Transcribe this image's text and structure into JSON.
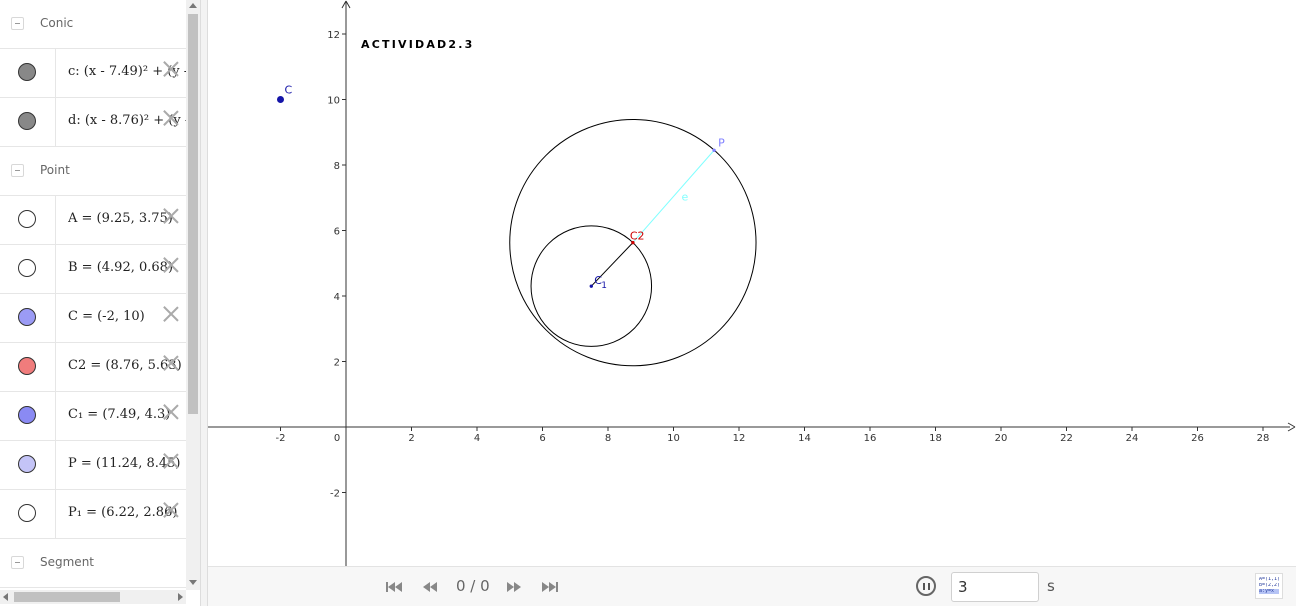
{
  "algebra": {
    "groups": [
      {
        "label": "Conic",
        "items": [
          {
            "color": "#888888",
            "text": "c: (x - 7.49)² + (y -"
          },
          {
            "color": "#888888",
            "text": "d: (x - 8.76)² + (y -"
          }
        ]
      },
      {
        "label": "Point",
        "items": [
          {
            "color": "#ffffff",
            "text": "A = (9.25, 3.75)"
          },
          {
            "color": "#ffffff",
            "text": "B = (4.92, 0.68)"
          },
          {
            "color": "#9b9bf5",
            "text": "C = (-2, 10)"
          },
          {
            "color": "#f07c7c",
            "text": "C2 = (8.76, 5.63)"
          },
          {
            "color": "#8a8af3",
            "text": "C₁ = (7.49, 4.3)"
          },
          {
            "color": "#c4c4f7",
            "text": "P = (11.24, 8.45)"
          },
          {
            "color": "#ffffff",
            "text": "P₁ = (6.22, 2.86)"
          }
        ]
      },
      {
        "label": "Segment",
        "items": []
      }
    ]
  },
  "graphics": {
    "title": "ACTIVIDAD2.3",
    "x_ticks": [
      "-2",
      "0",
      "2",
      "4",
      "6",
      "8",
      "10",
      "12",
      "14",
      "16",
      "18",
      "20",
      "22",
      "24",
      "26",
      "28"
    ],
    "y_ticks": [
      "12",
      "10",
      "8",
      "6",
      "4",
      "2",
      "-2"
    ],
    "objects": {
      "circle_c": {
        "center": [
          7.49,
          4.3
        ],
        "radius": 1.84,
        "color": "#000000"
      },
      "circle_d": {
        "center": [
          8.76,
          5.63
        ],
        "radius": 3.76,
        "color": "#000000"
      },
      "segment_e": {
        "from": [
          8.76,
          5.63
        ],
        "to": [
          11.24,
          8.45
        ],
        "color": "#80ffff",
        "label": "e"
      },
      "segment_c1_c2": {
        "from": [
          7.49,
          4.3
        ],
        "to": [
          8.76,
          5.63
        ],
        "color": "#000000"
      },
      "point_C": {
        "coords": [
          -2,
          10
        ],
        "label": "C",
        "color": "#1515a8"
      },
      "point_P": {
        "coords": [
          11.24,
          8.45
        ],
        "label": "P",
        "color": "#7f7fff"
      },
      "point_C2": {
        "coords": [
          8.76,
          5.63
        ],
        "label": "C2",
        "color": "#cc0000"
      },
      "point_C1": {
        "coords": [
          7.49,
          4.3
        ],
        "label": "C",
        "label_sub": "1",
        "color": "#1515a8"
      }
    }
  },
  "animation": {
    "frame_counter": "0 / 0",
    "speed_value": "3",
    "speed_unit": "s",
    "icons": [
      "skip-back-icon",
      "step-back-icon",
      "step-forward-icon",
      "skip-forward-icon",
      "pause-icon"
    ]
  },
  "input_bar_icon": {
    "lines": [
      "A=(1,1)",
      "B=(2,2)",
      "a:y=x"
    ]
  }
}
